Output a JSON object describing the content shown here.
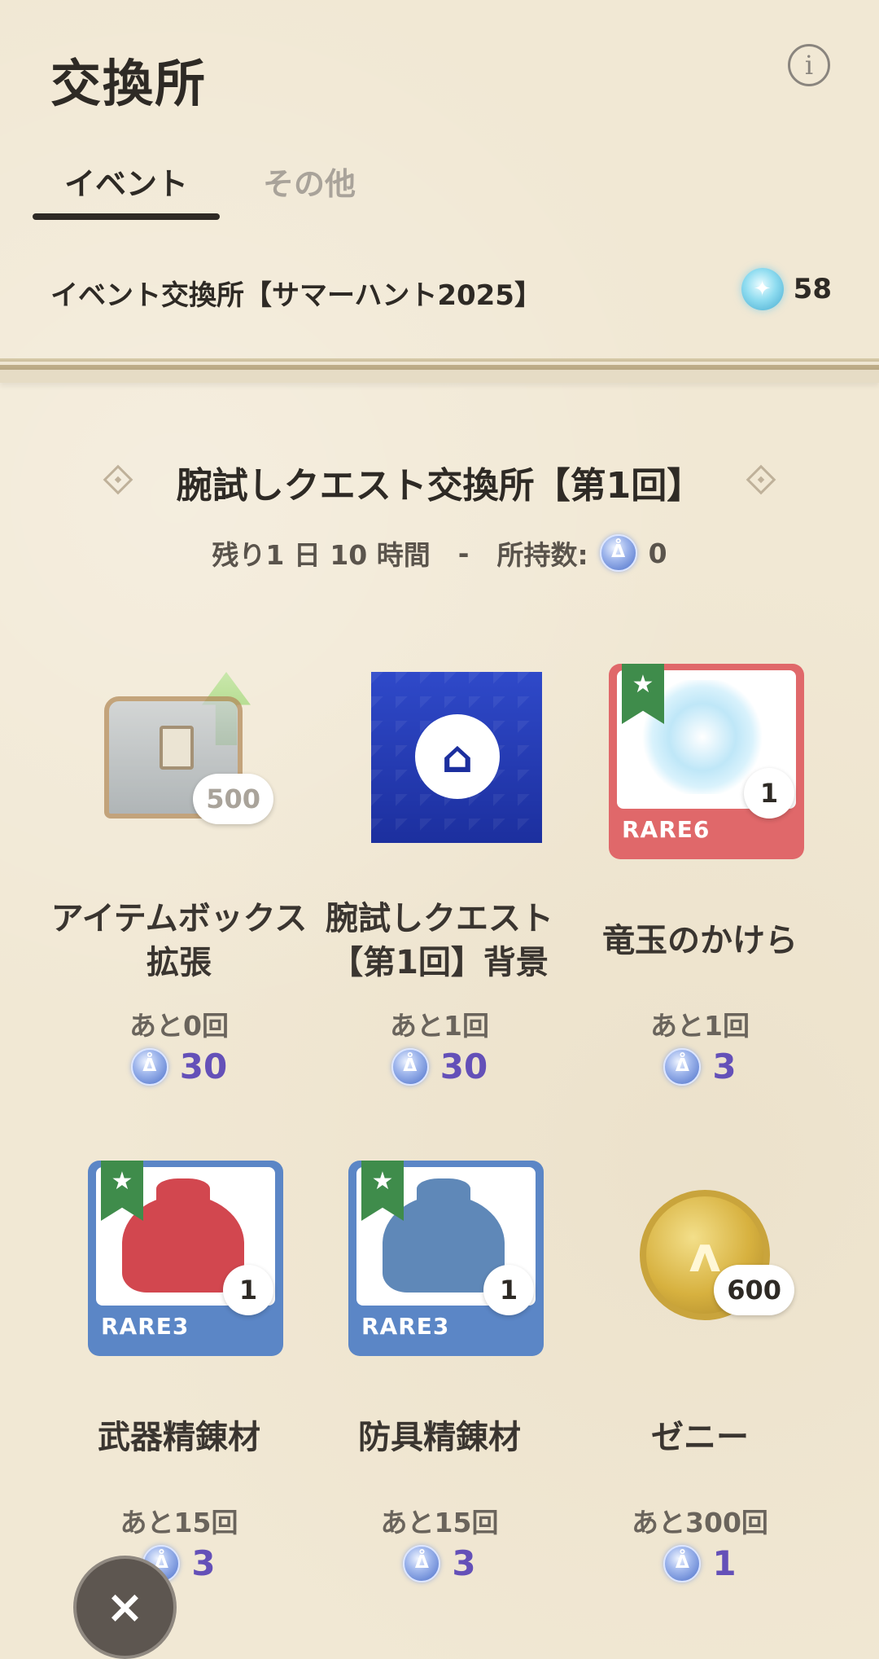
{
  "header": {
    "title": "交換所",
    "info_icon": "i"
  },
  "tabs": [
    {
      "label": "イベント",
      "active": true
    },
    {
      "label": "その他",
      "active": false
    }
  ],
  "shop": {
    "title": "イベント交換所【サマーハント2025】",
    "currency_count": "58"
  },
  "section": {
    "title": "腕試しクエスト交換所【第1回】",
    "remaining_label": "残り1 日 10 時間",
    "separator": "-",
    "owned_label": "所持数:",
    "owned_count": "0"
  },
  "items": [
    {
      "name": "アイテムボックス拡張",
      "badge": "500",
      "rarity": "",
      "remaining": "あと0回",
      "price": "30"
    },
    {
      "name": "腕試しクエスト【第1回】背景",
      "badge": "",
      "rarity": "",
      "remaining": "あと1回",
      "price": "30"
    },
    {
      "name": "竜玉のかけら",
      "badge": "1",
      "rarity": "RARE6",
      "remaining": "あと1回",
      "price": "3"
    },
    {
      "name": "武器精錬材",
      "badge": "1",
      "rarity": "RARE3",
      "remaining": "あと15回",
      "price": "3"
    },
    {
      "name": "防具精錬材",
      "badge": "1",
      "rarity": "RARE3",
      "remaining": "あと15回",
      "price": "3"
    },
    {
      "name": "ゼニー",
      "badge": "600",
      "rarity": "",
      "remaining": "あと300回",
      "price": "1"
    }
  ],
  "colors": {
    "rare6": "#e0686a",
    "rare3": "#5b86c6",
    "price": "#6450b8"
  },
  "close_icon": "×"
}
